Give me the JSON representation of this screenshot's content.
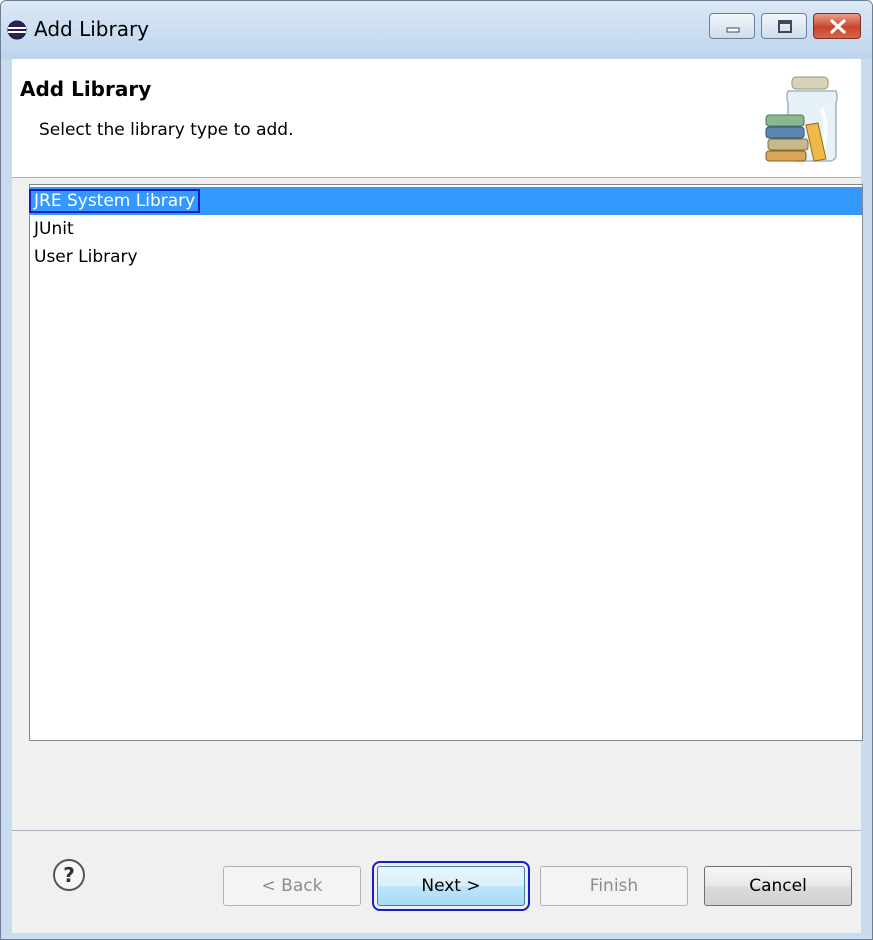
{
  "window": {
    "title": "Add Library",
    "icon": "eclipse-icon"
  },
  "banner": {
    "title": "Add Library",
    "description": "Select the library type to add.",
    "icon": "library-jar-icon"
  },
  "library_types": [
    {
      "label": "JRE System Library",
      "selected": true
    },
    {
      "label": "JUnit",
      "selected": false
    },
    {
      "label": "User Library",
      "selected": false
    }
  ],
  "buttons": {
    "back": "< Back",
    "next": "Next >",
    "finish": "Finish",
    "cancel": "Cancel"
  },
  "colors": {
    "selection": "#3399ff",
    "highlight_outline": "#1a1ac8"
  }
}
